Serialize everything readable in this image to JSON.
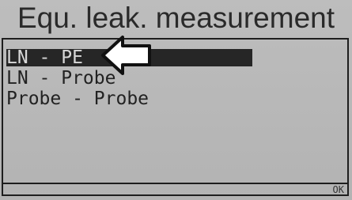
{
  "screen": {
    "title": "Equ. leak. measurement"
  },
  "menu": {
    "items": [
      {
        "label": "LN - PE",
        "selected": true
      },
      {
        "label": "LN - Probe",
        "selected": false
      },
      {
        "label": "Probe - Probe",
        "selected": false
      }
    ]
  },
  "status": {
    "ok_label": "OK"
  },
  "icons": {
    "pointer": "left-arrow-icon"
  },
  "colors": {
    "background": "#b8b8b8",
    "highlight": "#262626",
    "text": "#222222"
  }
}
